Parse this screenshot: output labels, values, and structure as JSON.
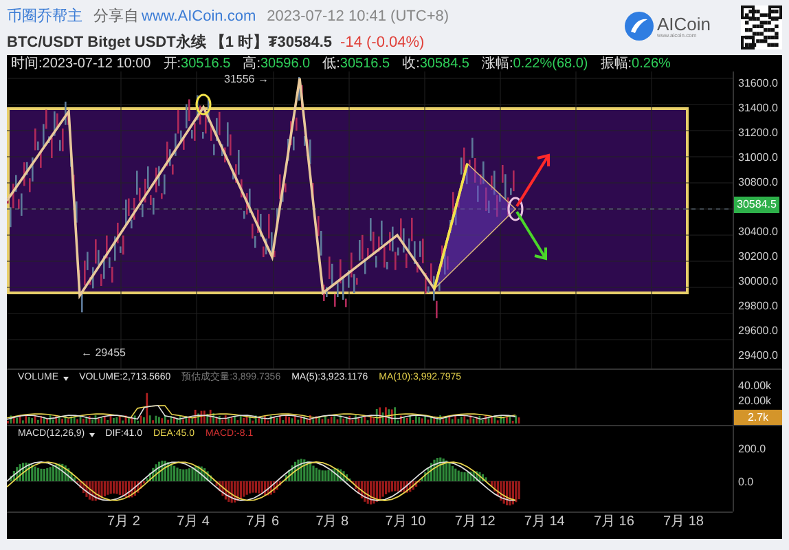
{
  "header": {
    "author": "币圈乔帮主",
    "share_label": "分享自",
    "share_link": "www.AICoin.com",
    "timestamp": "2023-07-12 10:41 (UTC+8)",
    "symbol": "BTC/USDT Bitget USDT永续 【1 时】₮30584.5",
    "change": "-14 (-0.04%)",
    "logo": "AICoin",
    "logo_url": "www.aicoin.com"
  },
  "info_bar": [
    {
      "kind": "time",
      "label": "时间:",
      "value": "2023-07-12 10:00"
    },
    {
      "kind": "quote",
      "label": "开:",
      "value": "30516.5"
    },
    {
      "kind": "quote",
      "label": "高:",
      "value": "30596.0"
    },
    {
      "kind": "quote",
      "label": "低:",
      "value": "30516.5"
    },
    {
      "kind": "quote",
      "label": "收:",
      "value": "30584.5"
    },
    {
      "kind": "quote",
      "label": "涨幅:",
      "value": "0.22%(68.0)"
    },
    {
      "kind": "quote",
      "label": "振幅:",
      "value": "0.26%"
    }
  ],
  "price_axis": [
    "31600.0",
    "31400.0",
    "31200.0",
    "31000.0",
    "30800.0",
    "30400.0",
    "30200.0",
    "30000.0",
    "29800.0",
    "29600.0",
    "29400.0"
  ],
  "current_price": "30584.5",
  "high_marker": "31556 →",
  "low_marker": "← 29455",
  "volume": {
    "selector": "VOLUME",
    "legend": [
      {
        "text": "VOLUME:2,713.5660",
        "color": "#e5e5e5"
      },
      {
        "text": "预估成交量:3,899.7356",
        "color": "#777777"
      },
      {
        "text": "MA(5):3,923.1176",
        "color": "#e5e5e5"
      },
      {
        "text": "MA(10):3,992.7975",
        "color": "#e8d44d"
      }
    ],
    "axis": [
      "40.00k",
      "20.00k"
    ],
    "current": "2.7k"
  },
  "macd": {
    "selector": "MACD(12,26,9)",
    "legend": [
      {
        "text": "DIF:41.0",
        "color": "#e5e5e5"
      },
      {
        "text": "DEA:45.0",
        "color": "#e8d44d"
      },
      {
        "text": "MACD:-8.1",
        "color": "#d23030"
      }
    ],
    "axis": [
      "200.0",
      "0.0"
    ]
  },
  "date_axis": [
    "7月 2",
    "7月 4",
    "7月 6",
    "7月 8",
    "7月 10",
    "7月 12",
    "7月 14",
    "7月 16",
    "7月 18"
  ]
}
